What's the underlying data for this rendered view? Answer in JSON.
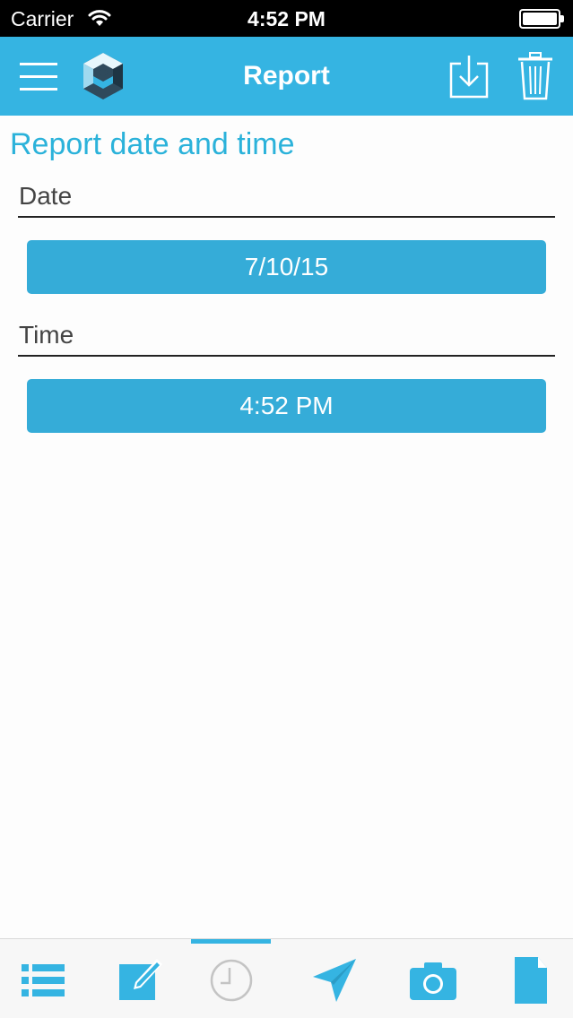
{
  "status_bar": {
    "carrier": "Carrier",
    "time": "4:52 PM"
  },
  "nav": {
    "title": "Report"
  },
  "content": {
    "section_title": "Report date and time",
    "date_label": "Date",
    "date_value": "7/10/15",
    "time_label": "Time",
    "time_value": "4:52 PM"
  },
  "tabs": [
    {
      "icon": "list-icon",
      "active": false
    },
    {
      "icon": "edit-icon",
      "active": false
    },
    {
      "icon": "clock-icon",
      "active": true
    },
    {
      "icon": "send-icon",
      "active": false
    },
    {
      "icon": "camera-icon",
      "active": false
    },
    {
      "icon": "document-icon",
      "active": false
    }
  ],
  "colors": {
    "accent": "#35b4e2",
    "button": "#35acd8",
    "section_title": "#2bb2da",
    "inactive_tab": "#c4c4c4"
  }
}
